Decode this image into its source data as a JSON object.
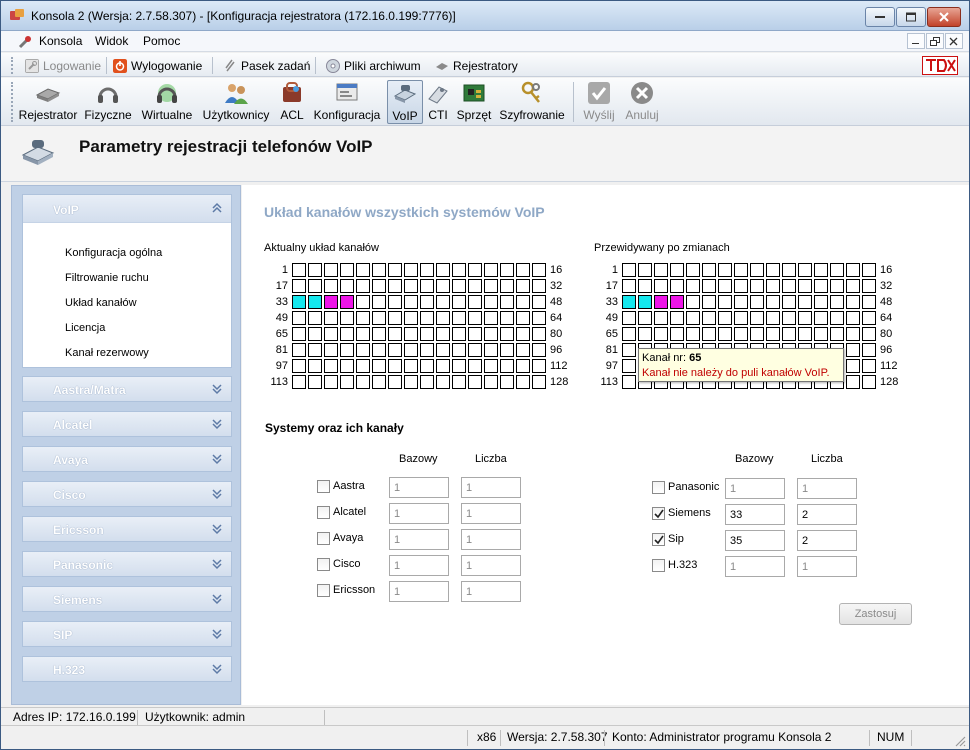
{
  "window": {
    "title": "Konsola 2 (Wersja:  2.7.58.307) - [Konfiguracja rejestratora (172.16.0.199:7776)]"
  },
  "menu": {
    "items": [
      "Konsola",
      "Widok",
      "Pomoc"
    ]
  },
  "toolbar1": {
    "login": "Logowanie",
    "logout": "Wylogowanie",
    "taskbar": "Pasek zadań",
    "archive": "Pliki archiwum",
    "recorders": "Rejestratory"
  },
  "toolbar2": {
    "items": [
      "Rejestrator",
      "Fizyczne",
      "Wirtualne",
      "Użytkownicy",
      "ACL",
      "Konfiguracja",
      "VoIP",
      "CTI",
      "Sprzęt",
      "Szyfrowanie",
      "Wyślij",
      "Anuluj"
    ]
  },
  "header": {
    "title": "Parametry rejestracji telefonów VoIP"
  },
  "sidebar": {
    "open_section": "VoIP",
    "sub_items": [
      "Konfiguracja ogólna",
      "Filtrowanie ruchu",
      "Układ kanałów",
      "Licencja",
      "Kanał rezerwowy"
    ],
    "sections": [
      "Aastra/Matra",
      "Alcatel",
      "Avaya",
      "Cisco",
      "Ericsson",
      "Panasonic",
      "Siemens",
      "SIP",
      "H.323"
    ]
  },
  "main": {
    "title": "Układ kanałów wszystkich systemów VoIP",
    "current_label": "Aktualny układ kanałów",
    "predicted_label": "Przewidywany po zmianach",
    "row_starts": [
      "1",
      "17",
      "33",
      "49",
      "65",
      "81",
      "97",
      "113"
    ],
    "row_ends": [
      "16",
      "32",
      "48",
      "64",
      "80",
      "96",
      "112",
      "128"
    ],
    "current_cells": {
      "cyan": [
        33,
        34
      ],
      "magenta": [
        35,
        36
      ]
    },
    "predicted_cells": {
      "cyan": [
        33,
        34
      ],
      "magenta": [
        35,
        36
      ]
    },
    "tooltip": {
      "prefix": "Kanał nr:",
      "number": "65",
      "message": "Kanał nie należy do puli kanałów VoIP."
    },
    "systems_title": "Systemy oraz ich kanały",
    "col_base": "Bazowy",
    "col_count": "Liczba",
    "systems_left": [
      {
        "name": "Aastra",
        "checked": false,
        "base": "1",
        "count": "1"
      },
      {
        "name": "Alcatel",
        "checked": false,
        "base": "1",
        "count": "1"
      },
      {
        "name": "Avaya",
        "checked": false,
        "base": "1",
        "count": "1"
      },
      {
        "name": "Cisco",
        "checked": false,
        "base": "1",
        "count": "1"
      },
      {
        "name": "Ericsson",
        "checked": false,
        "base": "1",
        "count": "1"
      }
    ],
    "systems_right": [
      {
        "name": "Panasonic",
        "checked": false,
        "base": "1",
        "count": "1"
      },
      {
        "name": "Siemens",
        "checked": true,
        "base": "33",
        "count": "2"
      },
      {
        "name": "Sip",
        "checked": true,
        "base": "35",
        "count": "2"
      },
      {
        "name": "H.323",
        "checked": false,
        "base": "1",
        "count": "1"
      }
    ],
    "apply": "Zastosuj"
  },
  "status": {
    "ip": "Adres IP: 172.16.0.199",
    "user": "Użytkownik: admin",
    "arch": "x86",
    "version": "Wersja: 2.7.58.307",
    "account": "Konto: Administrator programu Konsola 2",
    "num": "NUM"
  },
  "colors": {
    "cyan": "#14e8ee",
    "magenta": "#ee14e8",
    "tooltip_error": "#c00000",
    "section_title": "#8fa8c6"
  }
}
